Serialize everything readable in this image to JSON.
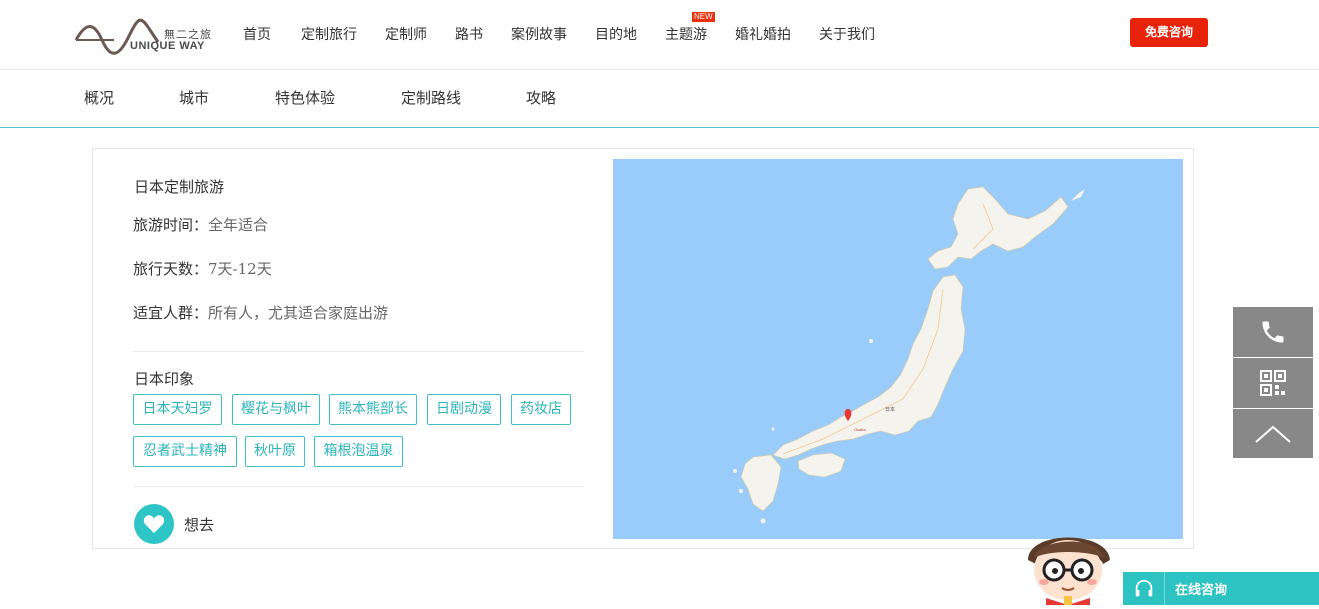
{
  "header": {
    "logo_cn": "無二之旅",
    "logo_en": "UNIQUE WAY",
    "nav": [
      {
        "label": "首页"
      },
      {
        "label": "定制旅行"
      },
      {
        "label": "定制师"
      },
      {
        "label": "路书"
      },
      {
        "label": "案例故事"
      },
      {
        "label": "目的地"
      },
      {
        "label": "主题游",
        "badge": "NEW"
      },
      {
        "label": "婚礼婚拍"
      },
      {
        "label": "关于我们"
      }
    ],
    "consult_button": "免费咨询"
  },
  "subnav": [
    "概况",
    "城市",
    "特色体验",
    "定制路线",
    "攻略"
  ],
  "destination": {
    "title": "日本定制旅游",
    "rows": [
      {
        "key": "旅游时间：",
        "value": "全年适合"
      },
      {
        "key": "旅行天数：",
        "value": "7天-12天"
      },
      {
        "key": "适宜人群：",
        "value": "所有人，尤其适合家庭出游"
      }
    ],
    "impression_title": "日本印象",
    "tags": [
      "日本天妇罗",
      "樱花与枫叶",
      "熊本熊部长",
      "日剧动漫",
      "药妆店",
      "忍者武士精神",
      "秋叶原",
      "箱根泡温泉"
    ],
    "want_label": "想去"
  },
  "map": {
    "labels": {
      "capital": "日本",
      "marker_city": "Osaka"
    },
    "water_color": "#99ccfa",
    "land_color": "#f5f3ee"
  },
  "side_panel": {
    "icons": [
      "phone-icon",
      "qrcode-icon",
      "back-to-top-icon"
    ]
  },
  "chat": {
    "label": "在线咨询"
  },
  "colors": {
    "accent": "#2ec5c7",
    "cta": "#e8230c",
    "side": "#888888"
  }
}
